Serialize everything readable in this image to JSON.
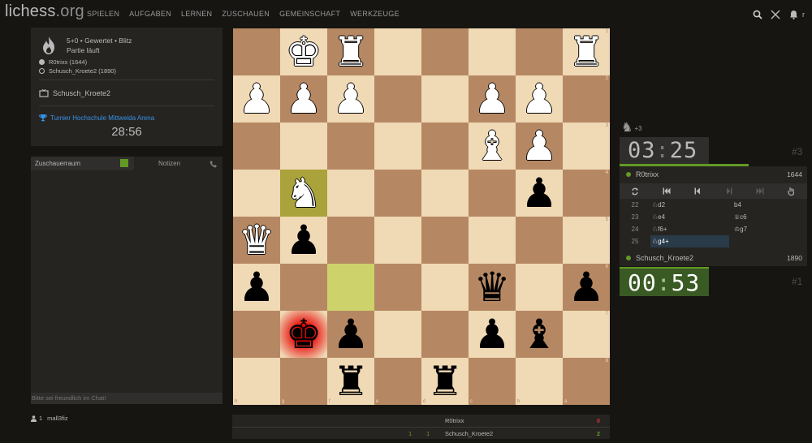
{
  "header": {
    "logo_main": "lichess",
    "logo_tld": ".org",
    "nav": [
      "SPIELEN",
      "AUFGABEN",
      "LERNEN",
      "ZUSCHAUEN",
      "GEMEINSCHAFT",
      "WERKZEUGE"
    ],
    "user_initial": "r"
  },
  "game": {
    "type": "5+0 • Gewertet • Blitz",
    "status": "Partie läuft",
    "player_white": "R0trixx (1644)",
    "player_black": "Schusch_Kroete2 (1890)",
    "team": "Schusch_Kroete2",
    "tournament": "Turnier Hochschule Mittweida Arena",
    "tournament_clock": "28:56"
  },
  "chat": {
    "tab_room": "Zuschauerraum",
    "tab_notes": "Notizen",
    "placeholder": "Bitte sei freundlich im Chat!"
  },
  "spectators": {
    "count": "1",
    "names": "mall3fiz"
  },
  "board": {
    "orientation": "black",
    "files_shown": [
      "h",
      "g",
      "f",
      "e",
      "d",
      "c",
      "b",
      "a"
    ],
    "ranks_shown": [
      "1",
      "2",
      "3",
      "4",
      "5",
      "6",
      "7",
      "8"
    ],
    "highlight_squares": [
      "g4",
      "f6"
    ],
    "check_square": "g7",
    "pieces": [
      {
        "sq": "g1",
        "piece": "wK"
      },
      {
        "sq": "f1",
        "piece": "wR"
      },
      {
        "sq": "a1",
        "piece": "wR"
      },
      {
        "sq": "h2",
        "piece": "wP"
      },
      {
        "sq": "g2",
        "piece": "wP"
      },
      {
        "sq": "f2",
        "piece": "wP"
      },
      {
        "sq": "c2",
        "piece": "wP"
      },
      {
        "sq": "b2",
        "piece": "wP"
      },
      {
        "sq": "c3",
        "piece": "wB"
      },
      {
        "sq": "b3",
        "piece": "wP"
      },
      {
        "sq": "g4",
        "piece": "wN"
      },
      {
        "sq": "b4",
        "piece": "bP"
      },
      {
        "sq": "h5",
        "piece": "wQ"
      },
      {
        "sq": "g5",
        "piece": "bP"
      },
      {
        "sq": "h6",
        "piece": "bP"
      },
      {
        "sq": "c6",
        "piece": "bQ"
      },
      {
        "sq": "a6",
        "piece": "bP"
      },
      {
        "sq": "g7",
        "piece": "bK"
      },
      {
        "sq": "f7",
        "piece": "bP"
      },
      {
        "sq": "c7",
        "piece": "bP"
      },
      {
        "sq": "b7",
        "piece": "bB"
      },
      {
        "sq": "f8",
        "piece": "bR"
      },
      {
        "sq": "d8",
        "piece": "bR"
      }
    ]
  },
  "crosstable": {
    "rows": [
      {
        "cells": [
          "",
          ""
        ],
        "name": "R0trixx",
        "total": "0"
      },
      {
        "cells": [
          "1",
          "1"
        ],
        "name": "Schusch_Kroete2",
        "total": "2"
      }
    ]
  },
  "right": {
    "material_diff": "+3",
    "clock_top": {
      "min": "03",
      "sec": "25"
    },
    "clock_bottom": {
      "min": "00",
      "sec": "53"
    },
    "move_no_top": "#3",
    "move_no_bottom": "#1",
    "player_top": {
      "name": "R0trixx",
      "rating": "1644"
    },
    "player_bottom": {
      "name": "Schusch_Kroete2",
      "rating": "1890"
    },
    "moves": [
      {
        "n": "22",
        "w": "♘d2",
        "b": "b4"
      },
      {
        "n": "23",
        "w": "♘e4",
        "b": "♕c6"
      },
      {
        "n": "24",
        "w": "♘f6+",
        "b": "♔g7"
      },
      {
        "n": "25",
        "w": "♘g4+",
        "b": ""
      }
    ],
    "active_move": "25w"
  },
  "colors": {
    "accent_green": "#629924",
    "link_blue": "#3692e7",
    "loss_red": "#cc3333"
  }
}
